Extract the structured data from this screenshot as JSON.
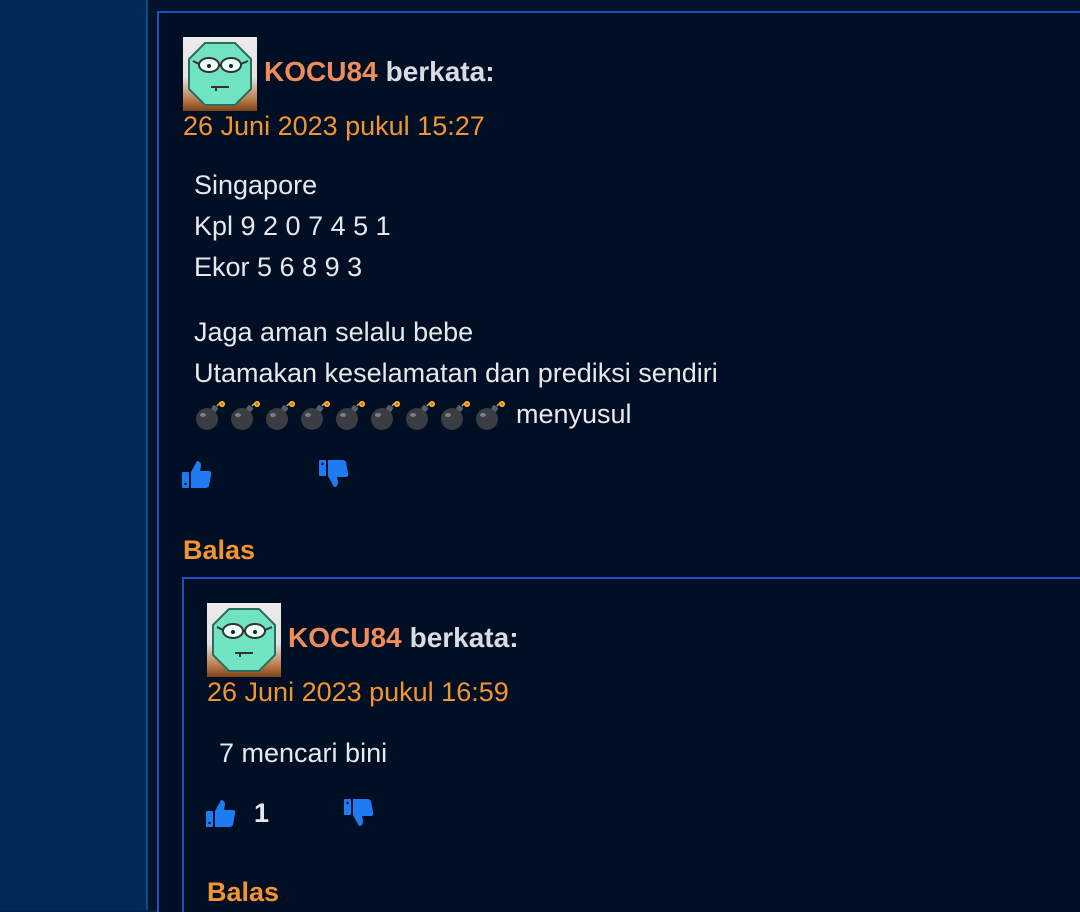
{
  "comments": [
    {
      "author": "KOCU84",
      "says": "berkata:",
      "date": "26 Juni 2023 pukul 15:27",
      "lines": [
        "Singapore",
        "Kpl 9 2 0 7 4 5 1",
        "Ekor 5 6 8 9 3"
      ],
      "lines2": [
        "Jaga aman selalu bebe",
        "Utamakan keselamatan dan prediksi sendiri"
      ],
      "bomb_count": 9,
      "bomb_suffix": "menyusul",
      "like_count": "",
      "reply": "Balas"
    },
    {
      "author": "KOCU84",
      "says": "berkata:",
      "date": "26 Juni 2023 pukul 16:59",
      "lines": [
        "7 mencari bini"
      ],
      "like_count": "1",
      "reply": "Balas"
    }
  ],
  "icons": {
    "like": "thumbs-up-icon",
    "dislike": "thumbs-down-icon",
    "emoji": "bomb-emoji"
  },
  "colors": {
    "author": "#f08b5a",
    "date": "#f39431",
    "accent": "#1f4fc6",
    "vote": "#1e7bf0"
  }
}
